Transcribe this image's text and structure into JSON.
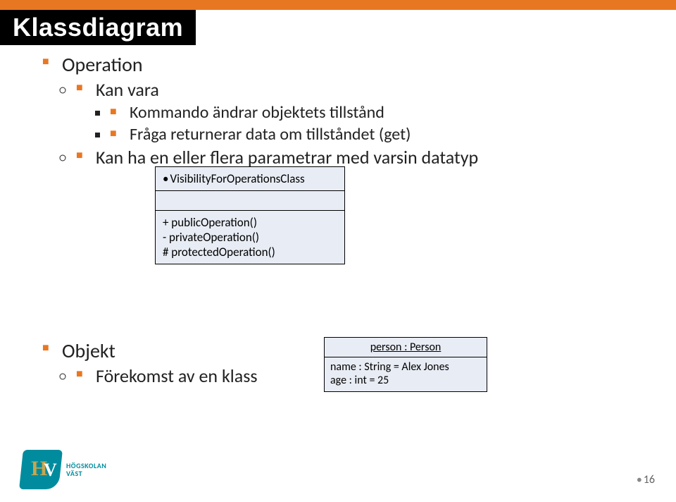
{
  "title": "Klassdiagram",
  "bullets": {
    "l1": "Operation",
    "l2a": "Kan vara",
    "l3a": "Kommando ändrar objektets tillstånd",
    "l3b": "Fråga returnerar data om tillståndet (get)",
    "l2b": "Kan ha en eller flera parametrar med varsin datatyp"
  },
  "uml1": {
    "name": "VisibilityForOperationsClass",
    "ops": {
      "op1": "+ publicOperation()",
      "op2": "- privateOperation()",
      "op3": "# protectedOperation()"
    }
  },
  "objekt": {
    "heading": "Objekt",
    "sub": "Förekomst av en klass"
  },
  "uml2": {
    "name": "person : Person",
    "attr1": "name : String = Alex Jones",
    "attr2": "age : int = 25"
  },
  "logo": {
    "line1": "HÖGSKOLAN",
    "line2": "VÄST"
  },
  "pageNumber": "16"
}
